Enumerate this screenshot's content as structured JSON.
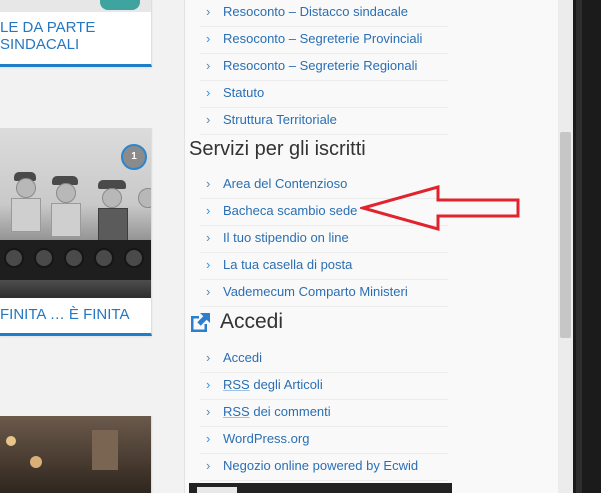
{
  "posts": [
    {
      "title_line1": "LE DA PARTE",
      "title_line2": "SINDACALI"
    },
    {
      "title": "FINITA … È FINITA",
      "comment_count": "1"
    },
    {
      "title": ""
    }
  ],
  "menu_top": {
    "items": [
      {
        "label": "Resoconto – Distacco sindacale"
      },
      {
        "label": "Resoconto – Segreterie Provinciali"
      },
      {
        "label": "Resoconto – Segreterie Regionali"
      },
      {
        "label": "Statuto"
      },
      {
        "label": "Struttura Territoriale"
      }
    ]
  },
  "servizi": {
    "title": "Servizi per gli iscritti",
    "items": [
      {
        "label": "Area del Contenzioso"
      },
      {
        "label": "Bacheca scambio sede"
      },
      {
        "label": "Il tuo stipendio on line"
      },
      {
        "label": "La tua casella di posta"
      },
      {
        "label": "Vademecum Comparto Ministeri"
      }
    ]
  },
  "accedi": {
    "title": "Accedi",
    "items": [
      {
        "label": "Accedi"
      },
      {
        "label_abbr": "RSS",
        "label_rest": " degli Articoli"
      },
      {
        "label_abbr": "RSS",
        "label_rest": " dei commenti"
      },
      {
        "label": "WordPress.org"
      },
      {
        "label": "Negozio online powered by Ecwid"
      }
    ]
  },
  "colors": {
    "link": "#2a6fb4",
    "accent": "#1e7ec8",
    "annotation_arrow": "#e0232c"
  },
  "icons": {
    "chevron": "chevron-right-icon",
    "external_link": "external-link-icon"
  }
}
